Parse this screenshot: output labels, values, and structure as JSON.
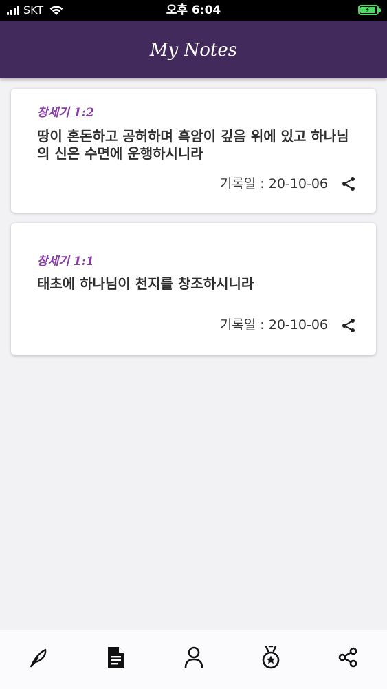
{
  "status_bar": {
    "carrier": "SKT",
    "time": "오후 6:04"
  },
  "header": {
    "title": "My Notes"
  },
  "notes": [
    {
      "reference": "창세기 1:2",
      "text": "땅이 혼돈하고 공허하며 흑암이 깊음 위에 있고 하나님의 신은 수면에 운행하시니라",
      "date_label": "기록일 : 20-10-06"
    },
    {
      "reference": "창세기 1:1",
      "text": "태초에 하나님이 천지를 창조하시니라",
      "date_label": "기록일 : 20-10-06"
    }
  ],
  "bottom_nav": {
    "items": [
      {
        "icon": "feather-icon"
      },
      {
        "icon": "document-icon"
      },
      {
        "icon": "person-icon"
      },
      {
        "icon": "medal-icon"
      },
      {
        "icon": "share-icon"
      }
    ]
  },
  "colors": {
    "header_bg": "#432a5c",
    "reference_text": "#8a3ca6",
    "page_bg": "#f2f1f4"
  }
}
